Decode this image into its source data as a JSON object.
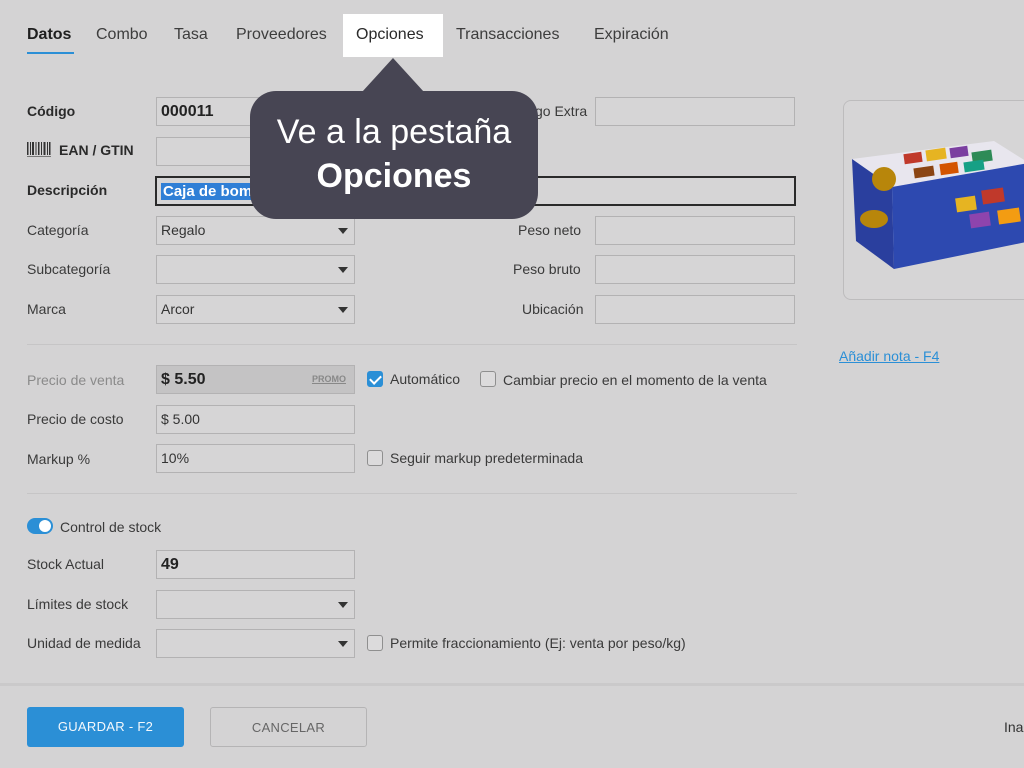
{
  "tabs": [
    {
      "label": "Datos",
      "active": true
    },
    {
      "label": "Combo"
    },
    {
      "label": "Tasa"
    },
    {
      "label": "Proveedores"
    },
    {
      "label": "Opciones",
      "highlighted": true
    },
    {
      "label": "Transacciones"
    },
    {
      "label": "Expiración"
    }
  ],
  "callout": {
    "line1": "Ve a la pestaña",
    "line2": "Opciones"
  },
  "form": {
    "codigo": {
      "label": "Código",
      "value": "000011"
    },
    "codigo_extra": {
      "label": "Código Extra",
      "visible_label": "go Extra",
      "value": ""
    },
    "ean": {
      "label": "EAN / GTIN",
      "value": "",
      "icon": "barcode-icon"
    },
    "descripcion": {
      "label": "Descripción",
      "value": "Caja de bom"
    },
    "categoria": {
      "label": "Categoría",
      "value": "Regalo"
    },
    "subcategoria": {
      "label": "Subcategoría",
      "value": ""
    },
    "marca": {
      "label": "Marca",
      "value": "Arcor"
    },
    "peso_neto": {
      "label": "Peso neto",
      "value": ""
    },
    "peso_bruto": {
      "label": "Peso bruto",
      "value": ""
    },
    "ubicacion": {
      "label": "Ubicación",
      "value": ""
    },
    "precio_venta": {
      "label": "Precio de venta",
      "value": "$ 5.50",
      "promo": "PROMO"
    },
    "automatico": {
      "label": "Automático",
      "checked": true
    },
    "cambiar_precio": {
      "label": "Cambiar precio en el momento de la venta",
      "checked": false
    },
    "precio_costo": {
      "label": "Precio de costo",
      "value": "$ 5.00"
    },
    "markup": {
      "label": "Markup %",
      "value": "10%"
    },
    "seguir_markup": {
      "label": "Seguir markup predeterminada",
      "checked": false
    },
    "control_stock": {
      "label": "Control de stock",
      "on": true
    },
    "stock_actual": {
      "label": "Stock Actual",
      "value": "49"
    },
    "limites_stock": {
      "label": "Límites de stock",
      "value": ""
    },
    "unidad_medida": {
      "label": "Unidad de medida",
      "value": ""
    },
    "fraccionamiento": {
      "label": "Permite fraccionamiento (Ej: venta por peso/kg)",
      "checked": false
    }
  },
  "side": {
    "add_note_link": "Añadir nota - F4"
  },
  "footer": {
    "save": "GUARDAR - F2",
    "cancel": "CANCELAR",
    "trailing": "Ina"
  },
  "colors": {
    "accent": "#2b8fd6",
    "callout": "#474553",
    "background": "#d4d3d4"
  }
}
